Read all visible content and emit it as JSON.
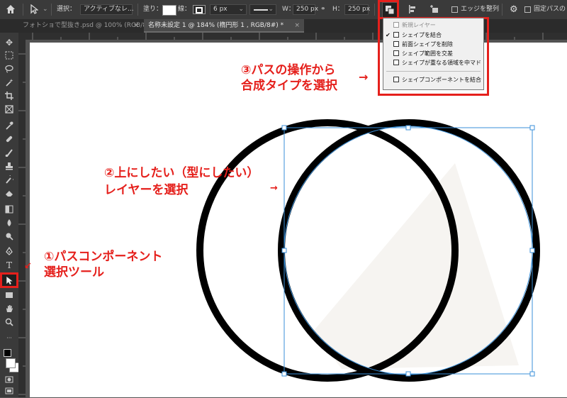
{
  "options_bar": {
    "select_label": "選択：",
    "select_value": "アクティブなレ...",
    "fill_label": "塗り：",
    "stroke_label": "線：",
    "stroke_width": "6 px",
    "w_label": "W：",
    "w_value": "250 px",
    "h_label": "H：",
    "h_value": "250 px",
    "align_edges_label": "エッジを整列",
    "fixed_path_label": "固定パスのドラ"
  },
  "tabs": [
    {
      "label": "フォトショで型抜き.psd @ 100% (RGB/8#)",
      "active": false
    },
    {
      "label": "名称未設定 1 @ 184% (楕円形 1 , RGB/8#) *",
      "active": true
    }
  ],
  "path_ops_menu": {
    "items": [
      {
        "label": "新規レイヤー",
        "disabled": true,
        "checked": false
      },
      {
        "label": "シェイプを結合",
        "disabled": false,
        "checked": true
      },
      {
        "label": "前面シェイプを削除",
        "disabled": false,
        "checked": false
      },
      {
        "label": "シェイプ範囲を交差",
        "disabled": false,
        "checked": false
      },
      {
        "label": "シェイプが重なる領域を中マド",
        "disabled": false,
        "checked": false
      },
      {
        "label": "シェイプコンポーネントを結合",
        "disabled": false,
        "checked": false
      }
    ],
    "checkmark": "✔"
  },
  "annotations": {
    "step1_line1": "①パスコンポーネント",
    "step1_line2": "選択ツール",
    "step2_line1": "②上にしたい（型にしたい）",
    "step2_line2": "レイヤーを選択",
    "step3_line1": "③パスの操作から",
    "step3_line2": "合成タイプを選択",
    "arrow_left": "←",
    "arrow_right": "→",
    "arrow_upleft": "↙"
  },
  "tool_text": {
    "type_tool": "T"
  },
  "colors": {
    "annotation_red": "#e5201c",
    "selection_blue": "#3a8fd8",
    "shape_stroke": "#000000",
    "ui_dark": "#3a3a3a"
  }
}
